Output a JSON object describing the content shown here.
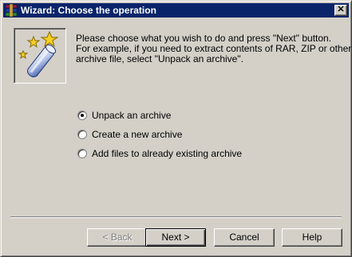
{
  "window": {
    "title": "Wizard:  Choose the operation",
    "close_symbol": "✕"
  },
  "hero": {
    "icon": "magic-wand-stars-icon"
  },
  "intro": {
    "line1": "Please choose what you wish to do and press \"Next\" button.",
    "line2": "For example, if you need to extract contents of RAR, ZIP or other",
    "line3": "archive file, select \"Unpack an archive\"."
  },
  "options": [
    {
      "label": "Unpack an archive",
      "selected": true
    },
    {
      "label": "Create a new archive",
      "selected": false
    },
    {
      "label": "Add files to already existing archive",
      "selected": false
    }
  ],
  "buttons": {
    "back": "< Back",
    "next": "Next >",
    "cancel": "Cancel",
    "help": "Help"
  },
  "colors": {
    "titlebar": "#0a246a",
    "face": "#d4d0c8"
  }
}
